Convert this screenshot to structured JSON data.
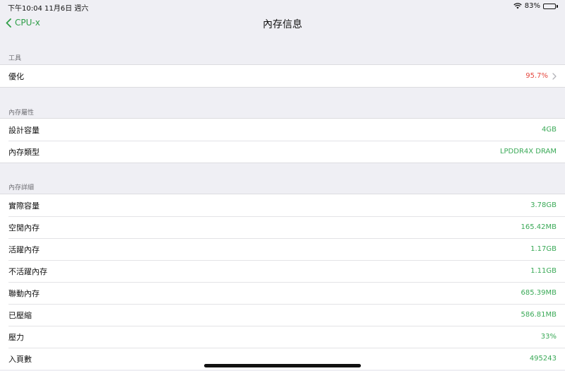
{
  "status_bar": {
    "left": "下午10:04   11月6日 週六",
    "battery": "83%",
    "battery_level": 0.83
  },
  "nav": {
    "back_label": "CPU-x",
    "title": "內存信息"
  },
  "sections": [
    {
      "header": "工具",
      "rows": [
        {
          "label": "優化",
          "value": "95.7%"
        }
      ]
    },
    {
      "header": "內存屬性",
      "rows": [
        {
          "label": "設計容量",
          "value": "4GB"
        },
        {
          "label": "內存類型",
          "value": "LPDDR4X DRAM"
        }
      ]
    },
    {
      "header": "內存詳細",
      "rows": [
        {
          "label": "實際容量",
          "value": "3.78GB"
        },
        {
          "label": "空閒內存",
          "value": "165.42MB"
        },
        {
          "label": "活躍內存",
          "value": "1.17GB"
        },
        {
          "label": "不活躍內存",
          "value": "1.11GB"
        },
        {
          "label": "聯動內存",
          "value": "685.39MB"
        },
        {
          "label": "已壓縮",
          "value": "586.81MB"
        },
        {
          "label": "壓力",
          "value": "33%"
        },
        {
          "label": "入頁數",
          "value": "495243"
        }
      ]
    }
  ],
  "colors": {
    "accent_green": "#2e9e47",
    "value_green": "#3aa957",
    "value_red": "#e5483f",
    "background": "#efeff4"
  }
}
